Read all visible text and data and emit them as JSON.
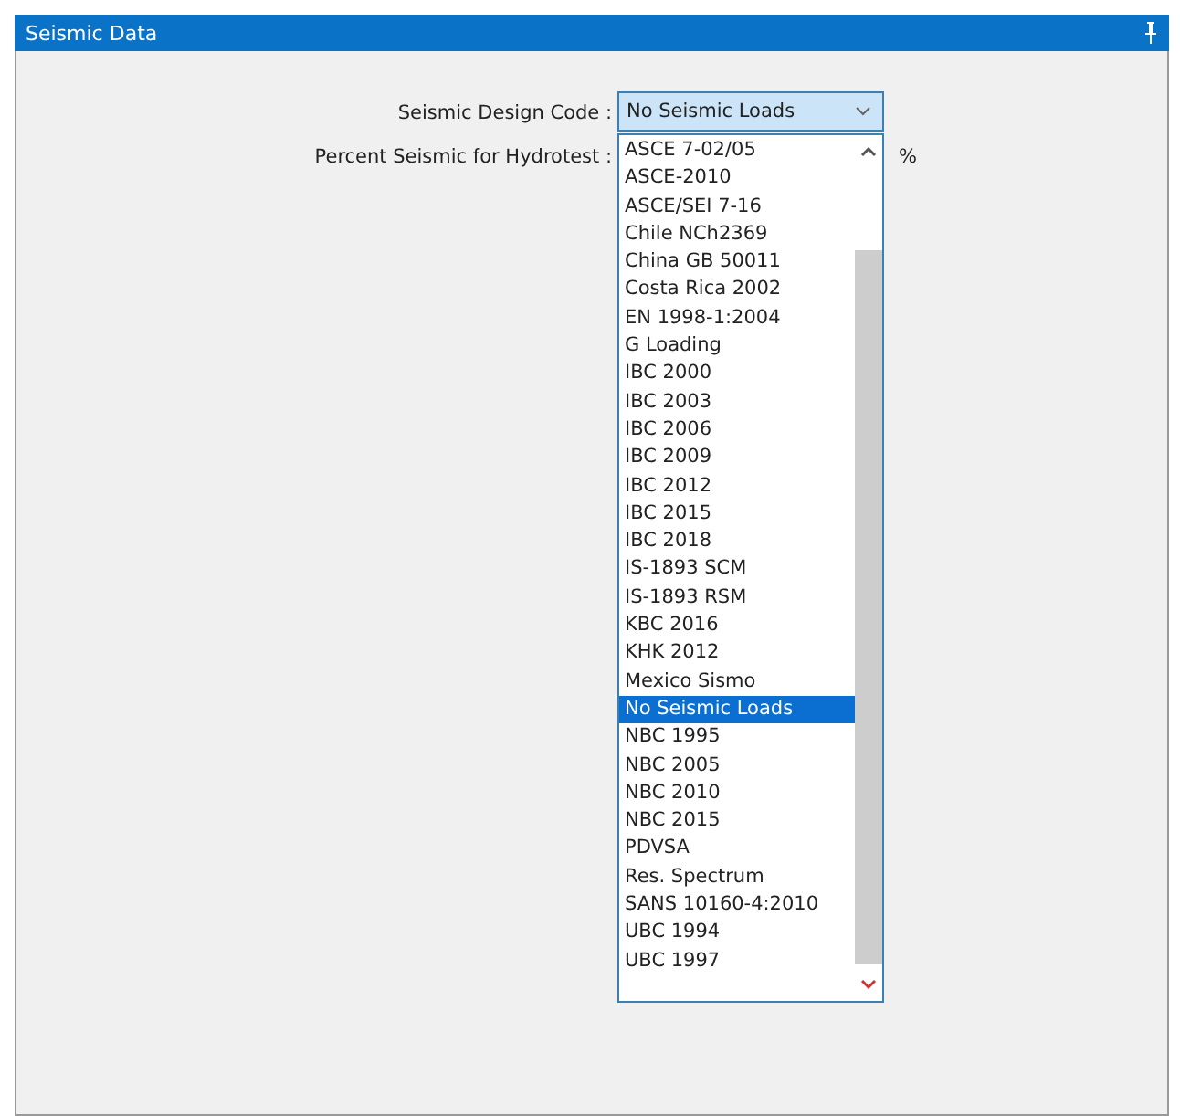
{
  "panel": {
    "title": "Seismic Data"
  },
  "fields": [
    {
      "label": "Seismic Design Code :",
      "value": "No Seismic Loads"
    },
    {
      "label": "Percent Seismic for Hydrotest :",
      "unit": "%"
    }
  ],
  "dropdown": {
    "options": [
      {
        "label": "ASCE 7-02/05",
        "selected": false
      },
      {
        "label": "ASCE-2010",
        "selected": false
      },
      {
        "label": "ASCE/SEI 7-16",
        "selected": false
      },
      {
        "label": "Chile NCh2369",
        "selected": false
      },
      {
        "label": "China GB 50011",
        "selected": false
      },
      {
        "label": "Costa Rica 2002",
        "selected": false
      },
      {
        "label": "EN 1998-1:2004",
        "selected": false
      },
      {
        "label": "G Loading",
        "selected": false
      },
      {
        "label": "IBC 2000",
        "selected": false
      },
      {
        "label": "IBC 2003",
        "selected": false
      },
      {
        "label": "IBC 2006",
        "selected": false
      },
      {
        "label": "IBC 2009",
        "selected": false
      },
      {
        "label": "IBC 2012",
        "selected": false
      },
      {
        "label": "IBC 2015",
        "selected": false
      },
      {
        "label": "IBC 2018",
        "selected": false
      },
      {
        "label": "IS-1893 SCM",
        "selected": false
      },
      {
        "label": "IS-1893 RSM",
        "selected": false
      },
      {
        "label": "KBC 2016",
        "selected": false
      },
      {
        "label": "KHK 2012",
        "selected": false
      },
      {
        "label": "Mexico Sismo",
        "selected": false
      },
      {
        "label": "No Seismic Loads",
        "selected": true
      },
      {
        "label": "NBC 1995",
        "selected": false
      },
      {
        "label": "NBC 2005",
        "selected": false
      },
      {
        "label": "NBC 2010",
        "selected": false
      },
      {
        "label": "NBC 2015",
        "selected": false
      },
      {
        "label": "PDVSA",
        "selected": false
      },
      {
        "label": "Res. Spectrum",
        "selected": false
      },
      {
        "label": "SANS 10160-4:2010",
        "selected": false
      },
      {
        "label": "UBC 1994",
        "selected": false
      },
      {
        "label": "UBC 1997",
        "selected": false
      }
    ]
  }
}
